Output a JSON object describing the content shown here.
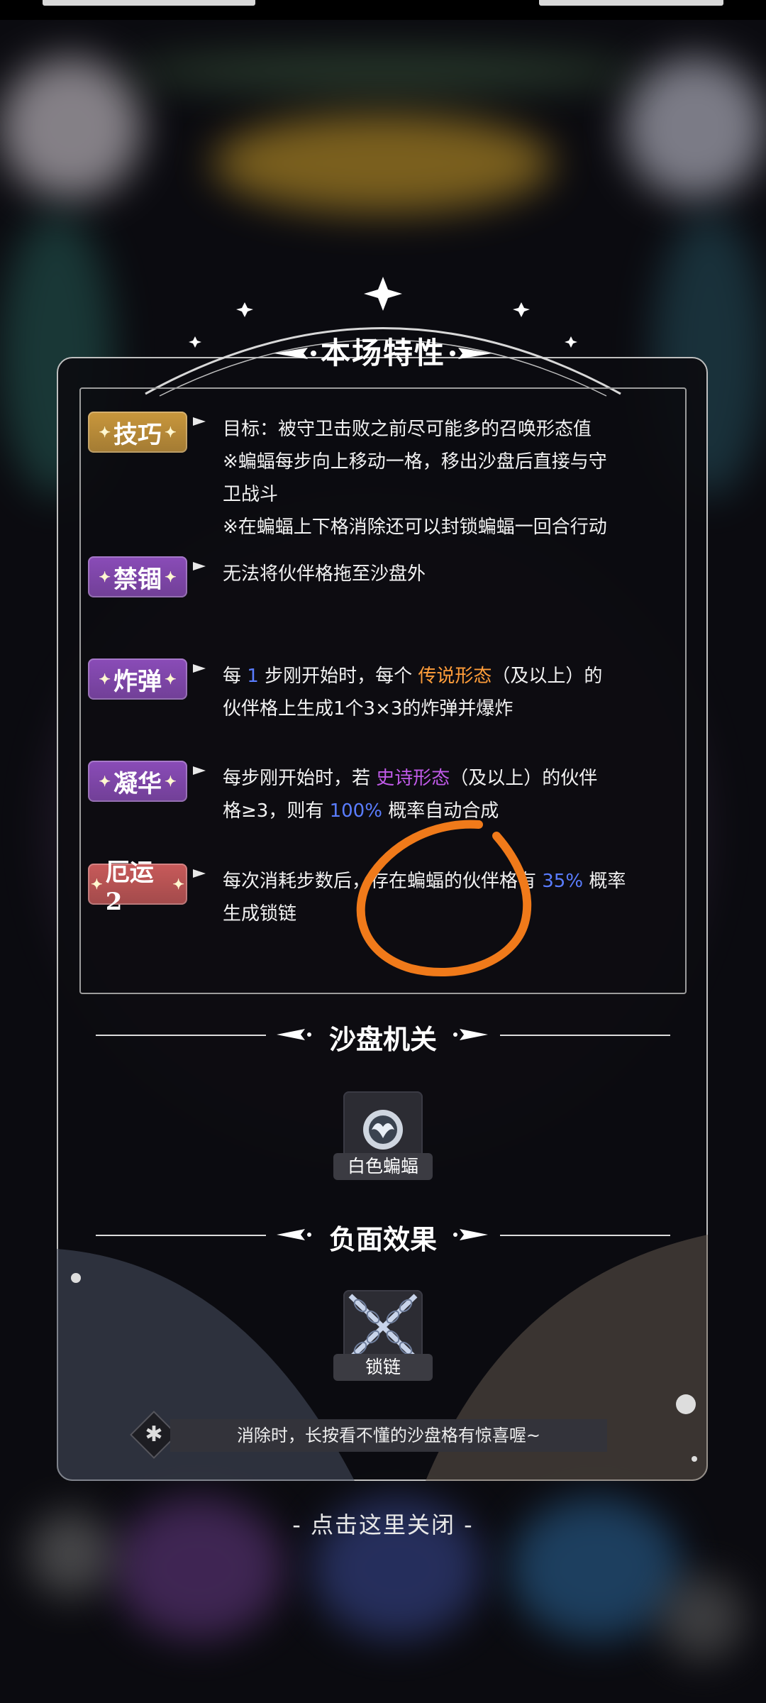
{
  "panel": {
    "title": "本场特性",
    "traits": [
      {
        "badge": "技巧",
        "color": "#c9973c",
        "lines": [
          [
            {
              "t": "目标：被守卫击败之前尽可能多的召唤形态值"
            }
          ],
          [
            {
              "t": "※蝙蝠每步向上移动一格，移出沙盘后直接与守"
            }
          ],
          [
            {
              "t": "卫战斗"
            }
          ],
          [
            {
              "t": "※在蝙蝠上下格消除还可以封锁蝙蝠一回合行动"
            }
          ]
        ]
      },
      {
        "badge": "禁锢",
        "color": "#8a4cb8",
        "lines": [
          [
            {
              "t": "无法将伙伴格拖至沙盘外"
            }
          ]
        ]
      },
      {
        "badge": "炸弹",
        "color": "#8a4cb8",
        "lines": [
          [
            {
              "t": "每 "
            },
            {
              "t": "1",
              "c": "c-blue"
            },
            {
              "t": " 步刚开始时，每个 "
            },
            {
              "t": "传说形态",
              "c": "c-orange"
            },
            {
              "t": "（及以上）的"
            }
          ],
          [
            {
              "t": "伙伴格上生成1个3×3的炸弹并爆炸"
            }
          ]
        ]
      },
      {
        "badge": "凝华",
        "color": "#8a4cb8",
        "lines": [
          [
            {
              "t": "每步刚开始时，若 "
            },
            {
              "t": "史诗形态",
              "c": "c-purple"
            },
            {
              "t": "（及以上）的伙伴"
            }
          ],
          [
            {
              "t": "格≥3，则有 "
            },
            {
              "t": "100%",
              "c": "c-blue"
            },
            {
              "t": " 概率自动合成"
            }
          ]
        ]
      },
      {
        "badge": "厄运2",
        "color": "#c85a5a",
        "lines": [
          [
            {
              "t": "每次消耗步数后，存在蝙蝠的伙伴格有 "
            },
            {
              "t": "35%",
              "c": "c-blue"
            },
            {
              "t": " 概率"
            }
          ],
          [
            {
              "t": "生成锁链"
            }
          ]
        ]
      }
    ],
    "mechanism_title": "沙盘机关",
    "mechanism_item": {
      "label": "白色蝙蝠",
      "icon": "white-bat-icon"
    },
    "negative_title": "负面效果",
    "negative_item": {
      "label": "锁链",
      "icon": "chain-icon"
    },
    "tip": "消除时，长按看不懂的沙盘格有惊喜喔~",
    "close": "- 点击这里关闭 -"
  }
}
